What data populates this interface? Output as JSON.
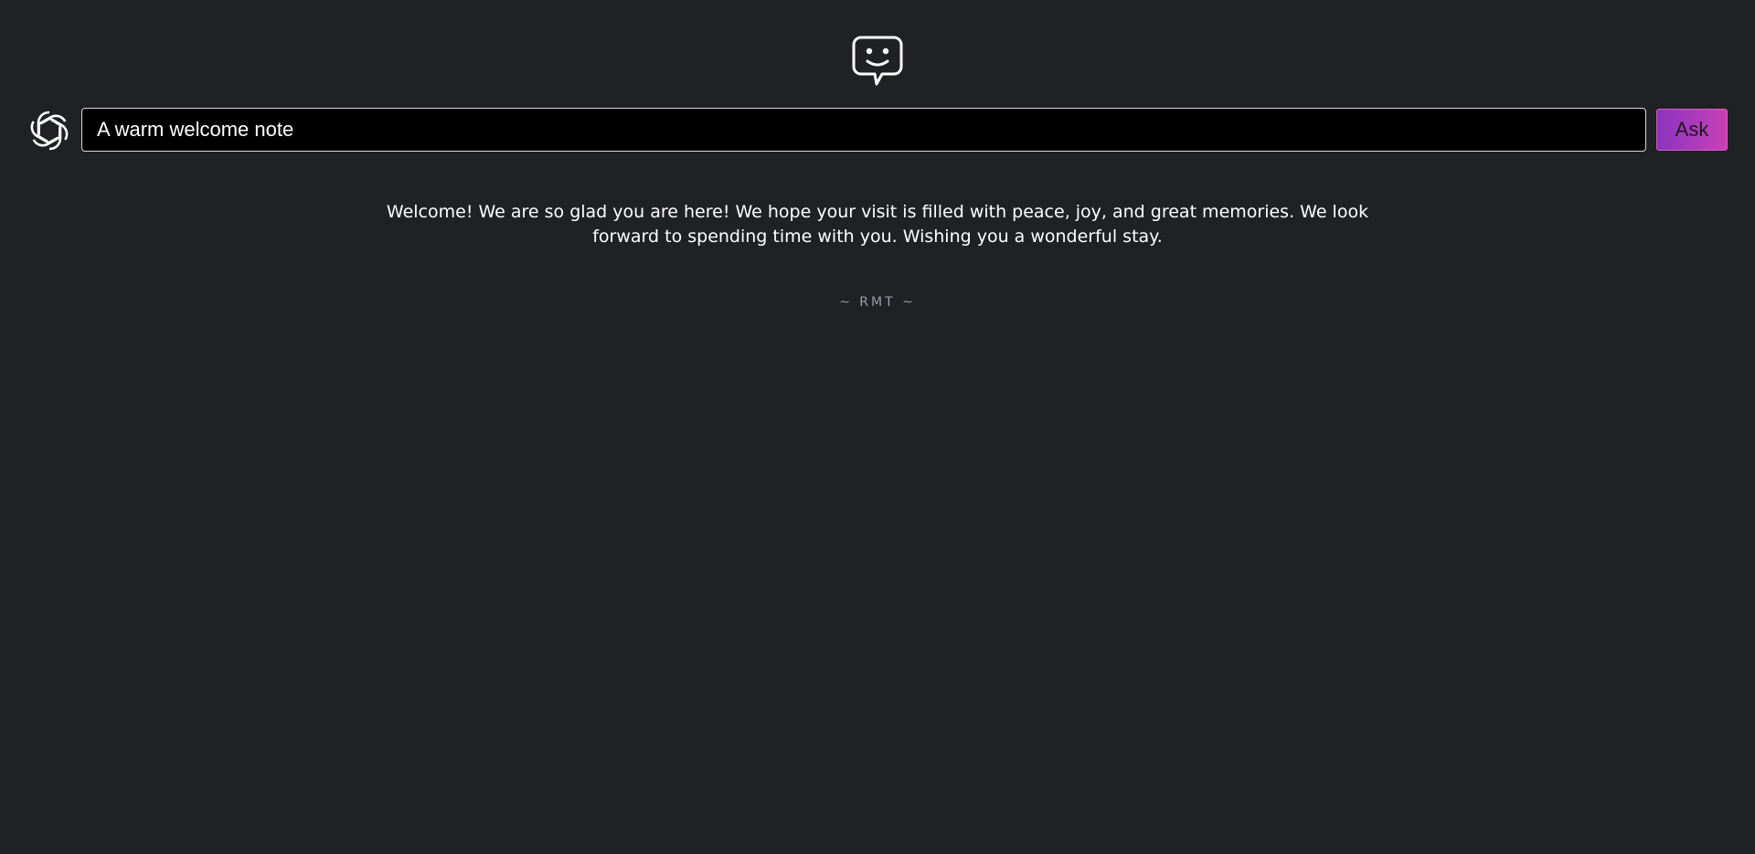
{
  "prompt": {
    "value": "A warm welcome note",
    "ask_label": "Ask"
  },
  "response": {
    "text": "Welcome! We are so glad you are here! We hope your visit is filled with peace, joy, and great memories. We look forward to spending time with you. Wishing you a wonderful stay."
  },
  "footer": {
    "signature": "~ RMT ~"
  },
  "icons": {
    "header": "smiley-chat-bubble-icon",
    "left": "openai-logo-icon"
  },
  "colors": {
    "background": "#202125",
    "input_background": "#000000",
    "button_gradient_start": "#8b34bf",
    "button_gradient_end": "#c941b8",
    "signature": "#9a9ca2"
  }
}
